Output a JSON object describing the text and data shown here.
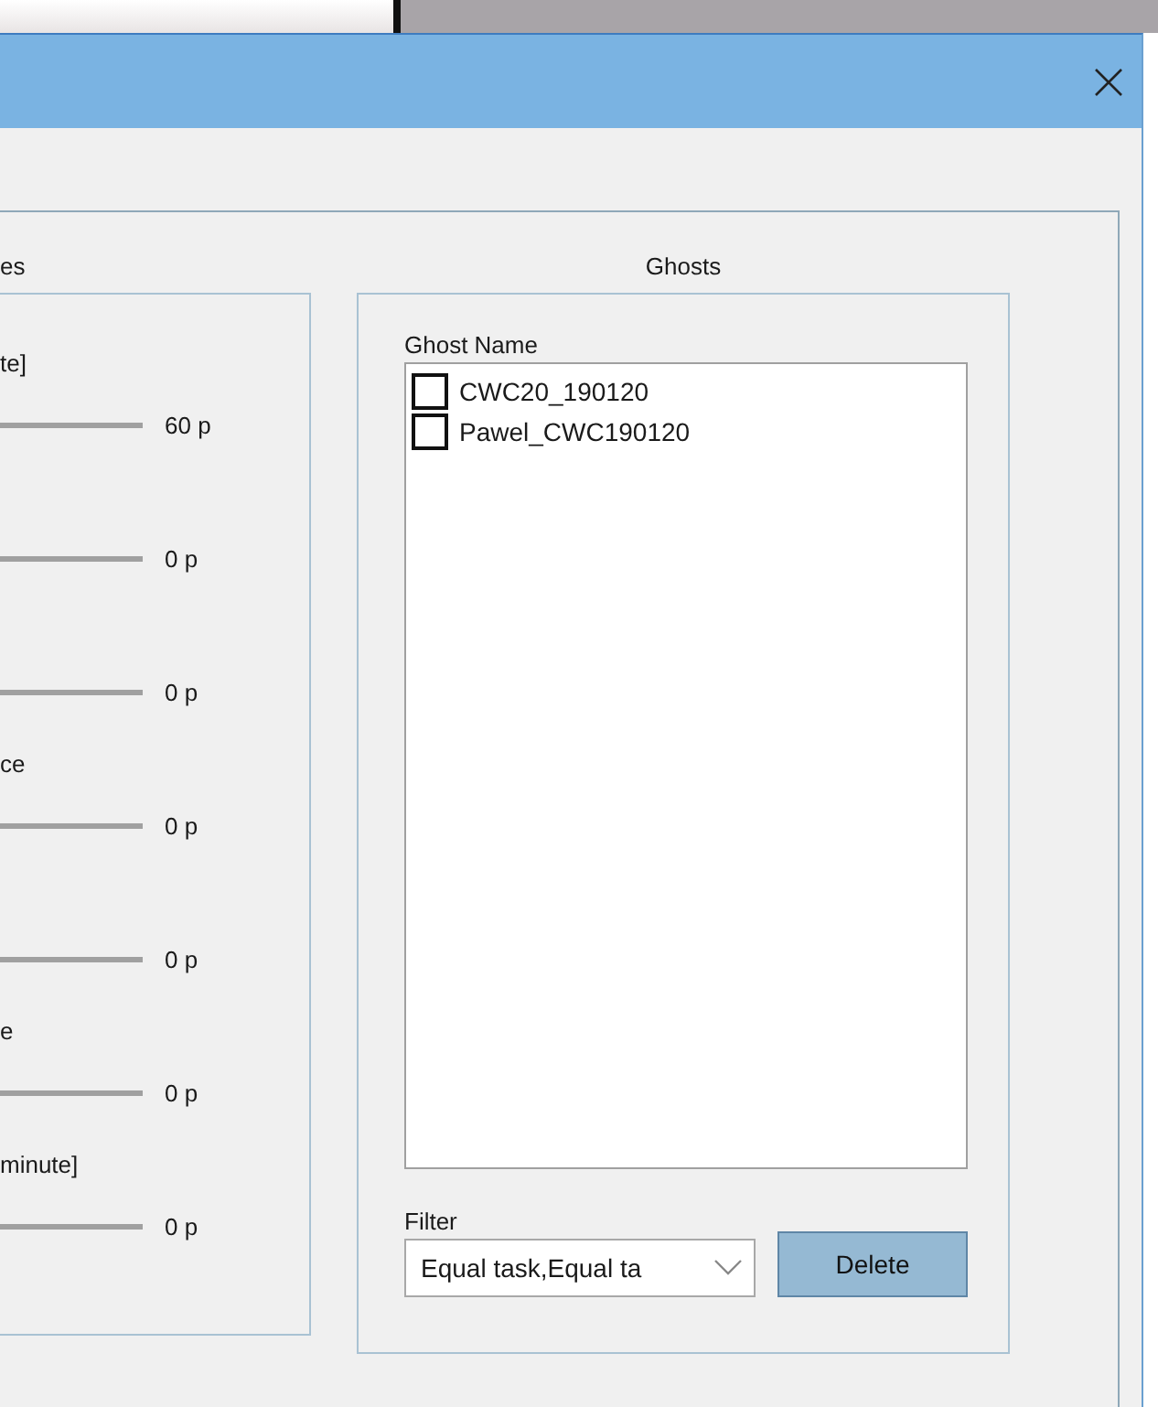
{
  "parameters_group": {
    "title": "es",
    "rows": [
      {
        "label": "te]",
        "reading": "60 p"
      },
      {
        "reading": "0 p"
      },
      {
        "reading": "0 p"
      },
      {
        "label": "ce",
        "reading": "0 p"
      },
      {
        "reading": "0 p"
      },
      {
        "label": "e",
        "reading": "0 p"
      },
      {
        "label": "minute]",
        "reading": "0 p"
      }
    ]
  },
  "ghosts_group": {
    "title": "Ghosts",
    "list_header": "Ghost Name",
    "items": [
      {
        "name": "CWC20_190120",
        "checked": false
      },
      {
        "name": "Pawel_CWC190120",
        "checked": false
      }
    ],
    "filter": {
      "label": "Filter",
      "value": "Equal task,Equal ta"
    },
    "delete_button": "Delete"
  }
}
